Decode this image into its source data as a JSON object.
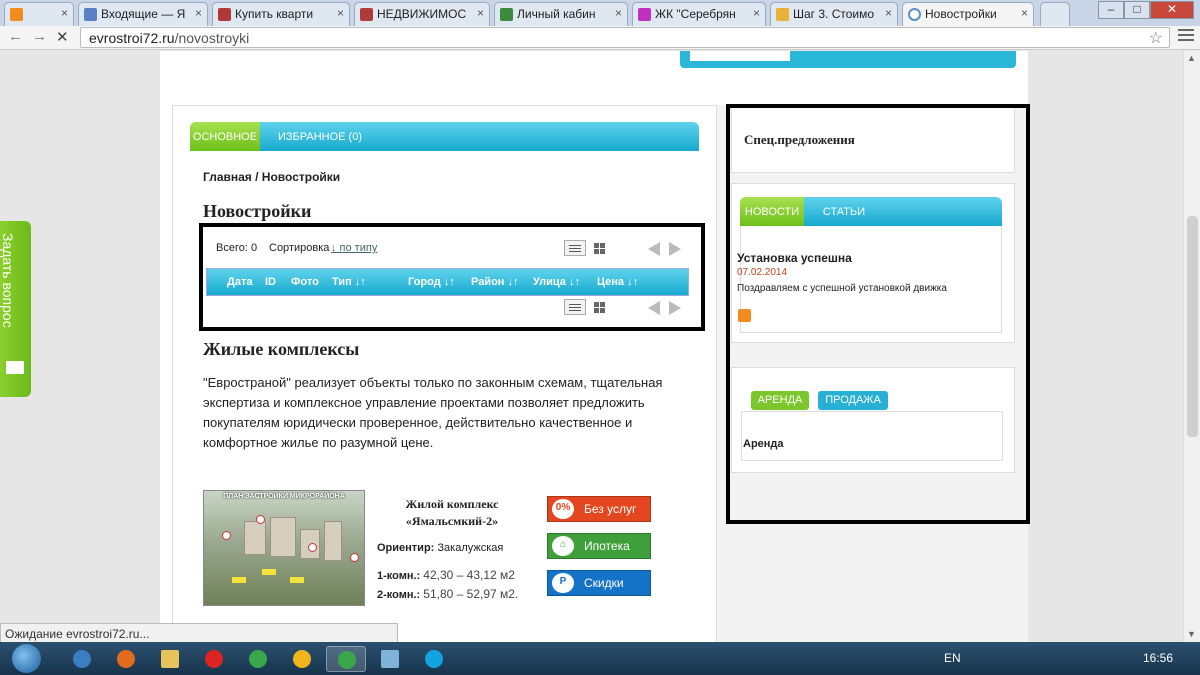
{
  "browser": {
    "tabs": [
      {
        "label": "",
        "favicon_color": "#f28a1e"
      },
      {
        "label": "Входящие — Я",
        "favicon_color": "#5a7fc2"
      },
      {
        "label": "Купить кварти",
        "favicon_color": "#b03a3a"
      },
      {
        "label": "НЕДВИЖИМОС",
        "favicon_color": "#b03a3a"
      },
      {
        "label": "Личный кабин",
        "favicon_color": "#3c8a3c"
      },
      {
        "label": "ЖК \"Серебрян",
        "favicon_color": "#c02fc0"
      },
      {
        "label": "Шаг 3. Стоимо",
        "favicon_color": "#e8b23a"
      },
      {
        "label": "Новостройки",
        "favicon_color": "#ffffff"
      }
    ],
    "url_host": "evrostroi72.ru",
    "url_path": "/novostroyki",
    "status_text": "Ожидание evrostroi72.ru..."
  },
  "left_tabs": {
    "main": "ОСНОВНОЕ",
    "favorites": "ИЗБРАННОЕ (0)"
  },
  "breadcrumb": "Главная / Новостройки",
  "page_title": "Новостройки",
  "results": {
    "total_label": "Всего: 0",
    "sort_label": "Сортировка",
    "sort_value": "↓ по типу",
    "columns": [
      "Дата",
      "ID",
      "Фото",
      "Тип ↓↑",
      "Город ↓↑",
      "Район ↓↑",
      "Улица ↓↑",
      "Цена ↓↑"
    ]
  },
  "section_title": "Жилые комплексы",
  "intro_text": "\"Евространой\" реализует объекты только по законным схемам, тщательная экспертиза и комплексное управление проектами позволяет предложить покупателям юридически проверенное, действительно качественное и комфортное жилье по разумной цене.",
  "complex": {
    "image_caption": "ПЛАН ЗАСТРОЙКИ МИКРОРАЙОНА",
    "name_line1": "Жилой комплекс",
    "name_line2": "«Ямальсмкий-2»",
    "landmark_label": "Ориентир:",
    "landmark_value": "Закалужская",
    "one_room_label": "1-комн.:",
    "one_room_value": "42,30 – 43,12 м2",
    "two_room_label": "2-комн.:",
    "two_room_value": "51,80 – 52,97 м2."
  },
  "cta": [
    {
      "label": "Без услуг",
      "icon_text": "0%",
      "color": "#e4471f"
    },
    {
      "label": "Ипотека",
      "icon_text": "⌂",
      "color": "#3f9f3a"
    },
    {
      "label": "Скидки",
      "icon_text": "P",
      "color": "#1473c6"
    }
  ],
  "sidebar": {
    "spec_title": "Спец.предложения",
    "news_tabs": {
      "news": "НОВОСТИ",
      "articles": "СТАТЬИ"
    },
    "news_item": {
      "title": "Установка успешна",
      "date": "07.02.2014",
      "text": "Поздравляем с успешной установкой движка"
    },
    "deal_tabs": {
      "rent": "АРЕНДА",
      "sale": "ПРОДАЖА"
    },
    "rent_text": "Аренда"
  },
  "feedback_tab": "Задать вопрос",
  "taskbar": {
    "lang": "EN",
    "time": "16:56"
  },
  "colors": {
    "accent_cyan": "#1fb3d6",
    "accent_green": "#6ec01c"
  }
}
